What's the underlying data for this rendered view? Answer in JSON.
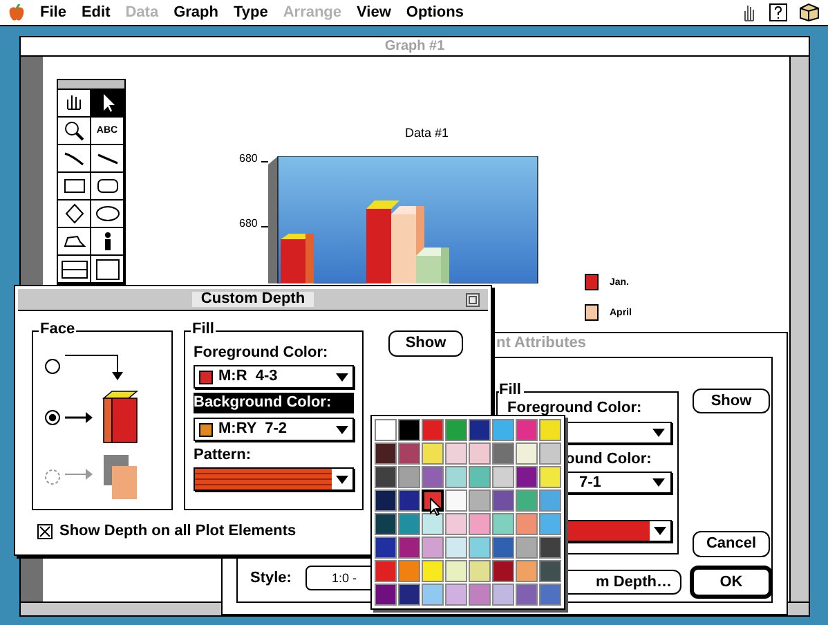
{
  "menu_bar": {
    "items": [
      {
        "label": "File",
        "disabled": false
      },
      {
        "label": "Edit",
        "disabled": false
      },
      {
        "label": "Data",
        "disabled": true
      },
      {
        "label": "Graph",
        "disabled": false
      },
      {
        "label": "Type",
        "disabled": false
      },
      {
        "label": "Arrange",
        "disabled": true
      },
      {
        "label": "View",
        "disabled": false
      },
      {
        "label": "Options",
        "disabled": false
      }
    ]
  },
  "graph_window": {
    "title": "Graph #1",
    "tools": [
      {
        "kind": "hand",
        "selected": false
      },
      {
        "kind": "arrow",
        "selected": true
      },
      {
        "kind": "zoom",
        "selected": false
      },
      {
        "kind": "text",
        "label": "ABC",
        "selected": false
      },
      {
        "kind": "curve",
        "selected": false
      },
      {
        "kind": "line",
        "selected": false
      },
      {
        "kind": "rect",
        "selected": false
      },
      {
        "kind": "round-rect",
        "selected": false
      },
      {
        "kind": "diamond",
        "selected": false
      },
      {
        "kind": "oval",
        "selected": false
      },
      {
        "kind": "polygon",
        "selected": false
      },
      {
        "kind": "figure",
        "selected": false
      },
      {
        "kind": "split",
        "selected": false
      },
      {
        "kind": "frame",
        "selected": false
      }
    ],
    "chart": {
      "title": "Data #1",
      "y_tick_labels": [
        "680",
        "680"
      ],
      "legend": [
        {
          "label": "Jan.",
          "color": "#d42020"
        },
        {
          "label": "April",
          "color": "#f5c8a8"
        }
      ]
    }
  },
  "plot_attributes_dialog": {
    "title": "nt Attributes",
    "fill_title": "Fill",
    "foreground_label": "Foreground Color:",
    "background_label": "ound Color:",
    "background_value": "7-1",
    "pattern": {
      "color": "#d82020"
    },
    "show_button": "Show",
    "cancel_button": "Cancel",
    "ok_button": "OK",
    "style_label": "Style:",
    "style_value": "1:0 -",
    "depth_button": "m Depth…"
  },
  "custom_depth_dialog": {
    "title": "Custom Depth",
    "face": {
      "title": "Face",
      "options": [
        {
          "kind": "top",
          "selected": false,
          "disabled": false
        },
        {
          "kind": "front",
          "selected": true,
          "disabled": false
        },
        {
          "kind": "shadow",
          "selected": false,
          "disabled": true
        }
      ]
    },
    "fill": {
      "title": "Fill",
      "foreground": {
        "label": "Foreground Color:",
        "value": "M:R  4-3",
        "color": "#d42828"
      },
      "background": {
        "label": "Background Color:",
        "highlighted": true,
        "value": "M:RY  7-2",
        "color": "#e08820"
      },
      "pattern": {
        "label": "Pattern:",
        "color": "#e04818"
      }
    },
    "show_button": "Show",
    "show_depth_checkbox": {
      "label": "Show Depth on all Plot Elements",
      "checked": true
    }
  },
  "color_palette": {
    "swatches": [
      {
        "color": "#ffffff",
        "selected": false
      },
      {
        "color": "#000000",
        "selected": false
      },
      {
        "color": "#e02020",
        "selected": false
      },
      {
        "color": "#20a040",
        "selected": false
      },
      {
        "color": "#1a2a8a",
        "selected": false
      },
      {
        "color": "#40b0e8",
        "selected": false
      },
      {
        "color": "#e0308a",
        "selected": false
      },
      {
        "color": "#f0e020",
        "selected": false
      },
      {
        "color": "#4a2020",
        "selected": false
      },
      {
        "color": "#a84060",
        "selected": false
      },
      {
        "color": "#f0e050",
        "selected": false
      },
      {
        "color": "#f0d0d8",
        "selected": false
      },
      {
        "color": "#f0c8d0",
        "selected": false
      },
      {
        "color": "#707070",
        "selected": false
      },
      {
        "color": "#f0f0d8",
        "selected": false
      },
      {
        "color": "#c8c8c8",
        "selected": false
      },
      {
        "color": "#404040",
        "selected": false
      },
      {
        "color": "#a0a0a0",
        "selected": false
      },
      {
        "color": "#9060b0",
        "selected": false
      },
      {
        "color": "#a0d8d8",
        "selected": false
      },
      {
        "color": "#60c0b0",
        "selected": false
      },
      {
        "color": "#d0d0d0",
        "selected": false
      },
      {
        "color": "#801890",
        "selected": false
      },
      {
        "color": "#f0e840",
        "selected": false
      },
      {
        "color": "#102050",
        "selected": false
      },
      {
        "color": "#202890",
        "selected": false
      },
      {
        "color": "#e03030",
        "selected": true
      },
      {
        "color": "#f8f8f8",
        "selected": false
      },
      {
        "color": "#b0b0b0",
        "selected": false
      },
      {
        "color": "#7050a0",
        "selected": false
      },
      {
        "color": "#40b080",
        "selected": false
      },
      {
        "color": "#50a8e0",
        "selected": false
      },
      {
        "color": "#104050",
        "selected": false
      },
      {
        "color": "#2090a0",
        "selected": false
      },
      {
        "color": "#c0e8e8",
        "selected": false
      },
      {
        "color": "#f0c8d8",
        "selected": false
      },
      {
        "color": "#f0a0c0",
        "selected": false
      },
      {
        "color": "#80d0c0",
        "selected": false
      },
      {
        "color": "#f09070",
        "selected": false
      },
      {
        "color": "#50b0e8",
        "selected": false
      },
      {
        "color": "#2030a0",
        "selected": false
      },
      {
        "color": "#a02080",
        "selected": false
      },
      {
        "color": "#d0a0d0",
        "selected": false
      },
      {
        "color": "#d0e8f0",
        "selected": false
      },
      {
        "color": "#80d0e0",
        "selected": false
      },
      {
        "color": "#3060b0",
        "selected": false
      },
      {
        "color": "#a8a8a8",
        "selected": false
      },
      {
        "color": "#404041",
        "selected": false
      },
      {
        "color": "#e02021",
        "selected": false
      },
      {
        "color": "#f08010",
        "selected": false
      },
      {
        "color": "#f8e820",
        "selected": false
      },
      {
        "color": "#e8f0c0",
        "selected": false
      },
      {
        "color": "#e0e090",
        "selected": false
      },
      {
        "color": "#a01020",
        "selected": false
      },
      {
        "color": "#f0a060",
        "selected": false
      },
      {
        "color": "#405050",
        "selected": false
      },
      {
        "color": "#701080",
        "selected": false
      },
      {
        "color": "#202880",
        "selected": false
      },
      {
        "color": "#90c8f0",
        "selected": false
      },
      {
        "color": "#d0b0e0",
        "selected": false
      },
      {
        "color": "#c080c0",
        "selected": false
      },
      {
        "color": "#c0b8e0",
        "selected": false
      },
      {
        "color": "#8060b0",
        "selected": false
      },
      {
        "color": "#5070c0",
        "selected": false
      }
    ]
  }
}
